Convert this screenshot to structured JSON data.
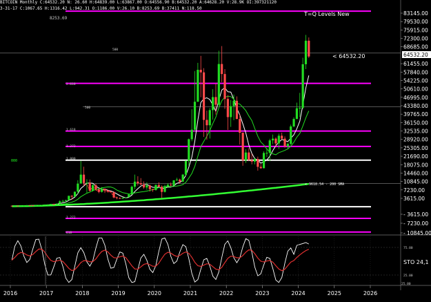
{
  "header": {
    "line1": "BITCOIN  Monthly  C:64532.20   N:  26.60   H:64839.00   L:63867.00   O:64556.90   B:64532.20   A:64628.20   V:28.9K   OI:397321120",
    "line2": "3-31-17  C:1067.65  H:1316.42  L:942.31  O:1186.00  V:26.10  B:8253.69  B:37411   N:118.50",
    "hi_marker": "8253.69"
  },
  "indicator_title": "T=Q Levels New",
  "price_callout": "< 64532.20",
  "price_box": "64532.20",
  "sma_label": "< 9618.54 - 200 SMA",
  "sto_label": "STO 24,1",
  "fib_labels": [
    "500",
    "2.618",
    "1.618",
    "1.272",
    "1.000",
    "500",
    "1.272",
    "618"
  ],
  "left_marker": "000",
  "lower_corner": "25.00",
  "chart_data": {
    "type": "candlestick",
    "x_ticks": [
      "2016",
      "2017",
      "2018",
      "2019",
      "2020",
      "2021",
      "2022",
      "2023",
      "2024",
      "2025",
      "2026"
    ],
    "y_ticks_upper": [
      "83145.00",
      "79530.00",
      "75915.00",
      "72300.00",
      "68685.00",
      "64532.20",
      "61455.00",
      "57840.00",
      "54225.00",
      "50610.00",
      "46995.00",
      "43380.00",
      "39765.00",
      "36150.00",
      "32535.00",
      "28920.00",
      "25305.00",
      "21690.00",
      "18075.00",
      "14460.00",
      "10845.00",
      "7230.00",
      "3615.00"
    ],
    "y_ticks_negative": [
      "- 3615.00",
      "- 7230.00",
      "- 10845.00"
    ],
    "y_ticks_lower": [
      "75.00",
      "25.00"
    ],
    "levels": [
      {
        "value": 84000,
        "color": "#ff00ff"
      },
      {
        "value": 53000,
        "color": "#ff00ff"
      },
      {
        "value": 32500,
        "color": "#ff00ff"
      },
      {
        "value": 25900,
        "color": "#ff00ff"
      },
      {
        "value": 20000,
        "color": "#ffffff"
      },
      {
        "value": 0,
        "color": "#ffffff"
      },
      {
        "value": -5000,
        "color": "#ff00ff"
      },
      {
        "value": -10845,
        "color": "#ff00ff"
      }
    ],
    "gray_levels": [
      66000,
      43000,
      10000
    ],
    "candles": [
      [
        "2016-01",
        430,
        380,
        440,
        370
      ],
      [
        "2016-02",
        380,
        435,
        440,
        375
      ],
      [
        "2016-03",
        435,
        416,
        440,
        410
      ],
      [
        "2016-04",
        416,
        448,
        460,
        410
      ],
      [
        "2016-05",
        448,
        530,
        540,
        440
      ],
      [
        "2016-06",
        530,
        670,
        780,
        520
      ],
      [
        "2016-07",
        670,
        625,
        690,
        600
      ],
      [
        "2016-08",
        625,
        575,
        630,
        540
      ],
      [
        "2016-09",
        575,
        608,
        610,
        570
      ],
      [
        "2016-10",
        608,
        700,
        720,
        600
      ],
      [
        "2016-11",
        700,
        745,
        750,
        680
      ],
      [
        "2016-12",
        745,
        960,
        980,
        740
      ],
      [
        "2017-01",
        960,
        965,
        1150,
        750
      ],
      [
        "2017-02",
        965,
        1190,
        1200,
        910
      ],
      [
        "2017-03",
        1190,
        1070,
        1320,
        890
      ],
      [
        "2017-04",
        1070,
        1350,
        1360,
        1060
      ],
      [
        "2017-05",
        1350,
        2300,
        2800,
        1340
      ],
      [
        "2017-06",
        2300,
        2490,
        3000,
        2100
      ],
      [
        "2017-07",
        2490,
        2870,
        2950,
        1800
      ],
      [
        "2017-08",
        2870,
        4700,
        4750,
        2700
      ],
      [
        "2017-09",
        4700,
        4340,
        5000,
        2950
      ],
      [
        "2017-10",
        4340,
        6470,
        6500,
        4200
      ],
      [
        "2017-11",
        6470,
        9950,
        11400,
        5500
      ],
      [
        "2017-12",
        9950,
        13800,
        19700,
        10700
      ],
      [
        "2018-01",
        13800,
        10200,
        17200,
        9000
      ],
      [
        "2018-02",
        10200,
        10300,
        11800,
        6000
      ],
      [
        "2018-03",
        10300,
        6900,
        11700,
        6600
      ],
      [
        "2018-04",
        6900,
        9240,
        9750,
        6500
      ],
      [
        "2018-05",
        9240,
        7500,
        9990,
        7000
      ],
      [
        "2018-06",
        7500,
        6400,
        7780,
        5800
      ],
      [
        "2018-07",
        6400,
        7730,
        8500,
        6100
      ],
      [
        "2018-08",
        7730,
        7000,
        7750,
        5900
      ],
      [
        "2018-09",
        7000,
        6600,
        7400,
        6100
      ],
      [
        "2018-10",
        6600,
        6300,
        6800,
        6200
      ],
      [
        "2018-11",
        6300,
        4000,
        6500,
        3600
      ],
      [
        "2018-12",
        4000,
        3700,
        4400,
        3200
      ],
      [
        "2019-01",
        3700,
        3450,
        4100,
        3350
      ],
      [
        "2019-02",
        3450,
        3800,
        4200,
        3400
      ],
      [
        "2019-03",
        3800,
        4100,
        4150,
        3700
      ],
      [
        "2019-04",
        4100,
        5300,
        5600,
        4050
      ],
      [
        "2019-05",
        5300,
        8600,
        9100,
        5250
      ],
      [
        "2019-06",
        8600,
        10800,
        13800,
        7500
      ],
      [
        "2019-07",
        10800,
        10100,
        13100,
        9100
      ],
      [
        "2019-08",
        10100,
        9600,
        12300,
        9300
      ],
      [
        "2019-09",
        9600,
        8300,
        10900,
        7700
      ],
      [
        "2019-10",
        8300,
        9150,
        10500,
        7300
      ],
      [
        "2019-11",
        9150,
        7550,
        9500,
        6500
      ],
      [
        "2019-12",
        7550,
        7200,
        7700,
        6400
      ],
      [
        "2020-01",
        7200,
        9350,
        9600,
        6900
      ],
      [
        "2020-02",
        9350,
        8550,
        10500,
        8450
      ],
      [
        "2020-03",
        8550,
        6400,
        9200,
        3800
      ],
      [
        "2020-04",
        6400,
        8650,
        9450,
        6150
      ],
      [
        "2020-05",
        8650,
        9450,
        10100,
        8100
      ],
      [
        "2020-06",
        9450,
        9150,
        10400,
        8900
      ],
      [
        "2020-07",
        9150,
        11350,
        11450,
        9000
      ],
      [
        "2020-08",
        11350,
        11650,
        12450,
        11100
      ],
      [
        "2020-09",
        11650,
        10800,
        12100,
        9900
      ],
      [
        "2020-10",
        10800,
        13800,
        14100,
        10500
      ],
      [
        "2020-11",
        13800,
        19700,
        19900,
        13200
      ],
      [
        "2020-12",
        19700,
        29000,
        29300,
        17600
      ],
      [
        "2021-01",
        29000,
        33100,
        41900,
        28100
      ],
      [
        "2021-02",
        33100,
        45100,
        58300,
        32300
      ],
      [
        "2021-03",
        45100,
        58800,
        61800,
        45000
      ],
      [
        "2021-04",
        58800,
        57700,
        64800,
        47000
      ],
      [
        "2021-05",
        57700,
        37300,
        59500,
        30000
      ],
      [
        "2021-06",
        37300,
        35000,
        41300,
        28800
      ],
      [
        "2021-07",
        35000,
        41500,
        42400,
        29300
      ],
      [
        "2021-08",
        41500,
        47100,
        50500,
        37400
      ],
      [
        "2021-09",
        47100,
        43800,
        52900,
        39600
      ],
      [
        "2021-10",
        43800,
        61300,
        67000,
        43300
      ],
      [
        "2021-11",
        61300,
        57000,
        69000,
        53500
      ],
      [
        "2021-12",
        57000,
        46300,
        59100,
        42000
      ],
      [
        "2022-01",
        46300,
        38500,
        48000,
        33000
      ],
      [
        "2022-02",
        38500,
        43200,
        45800,
        34300
      ],
      [
        "2022-03",
        43200,
        45500,
        48200,
        37200
      ],
      [
        "2022-04",
        45500,
        37700,
        47400,
        37600
      ],
      [
        "2022-05",
        37700,
        31800,
        39800,
        26700
      ],
      [
        "2022-06",
        31800,
        19900,
        31900,
        17600
      ],
      [
        "2022-07",
        19900,
        23300,
        24700,
        18800
      ],
      [
        "2022-08",
        23300,
        20050,
        25200,
        19600
      ],
      [
        "2022-09",
        20050,
        19400,
        22800,
        18200
      ],
      [
        "2022-10",
        19400,
        20500,
        21000,
        18200
      ],
      [
        "2022-11",
        20500,
        17150,
        21500,
        15500
      ],
      [
        "2022-12",
        17150,
        16550,
        18400,
        16300
      ],
      [
        "2023-01",
        16550,
        23100,
        23800,
        16500
      ],
      [
        "2023-02",
        23100,
        23150,
        25250,
        21400
      ],
      [
        "2023-03",
        23150,
        28500,
        29200,
        19600
      ],
      [
        "2023-04",
        28500,
        29250,
        31000,
        26900
      ],
      [
        "2023-05",
        29250,
        27200,
        29800,
        25800
      ],
      [
        "2023-06",
        27200,
        30500,
        31400,
        24800
      ],
      [
        "2023-07",
        30500,
        29250,
        31800,
        28900
      ],
      [
        "2023-08",
        29250,
        25950,
        30200,
        25400
      ],
      [
        "2023-09",
        25950,
        27000,
        27500,
        24900
      ],
      [
        "2023-10",
        27000,
        34500,
        35300,
        26600
      ],
      [
        "2023-11",
        34500,
        37700,
        38400,
        34100
      ],
      [
        "2023-12",
        37700,
        42300,
        44700,
        37600
      ],
      [
        "2024-01",
        42300,
        42500,
        48900,
        38600
      ],
      [
        "2024-02",
        42500,
        61200,
        64000,
        41900
      ],
      [
        "2024-03",
        61200,
        71300,
        73800,
        59100
      ],
      [
        "2024-04",
        71300,
        64532,
        72700,
        63900
      ]
    ],
    "sma_200_end": 9618.54,
    "sto_latest": 24.1
  }
}
